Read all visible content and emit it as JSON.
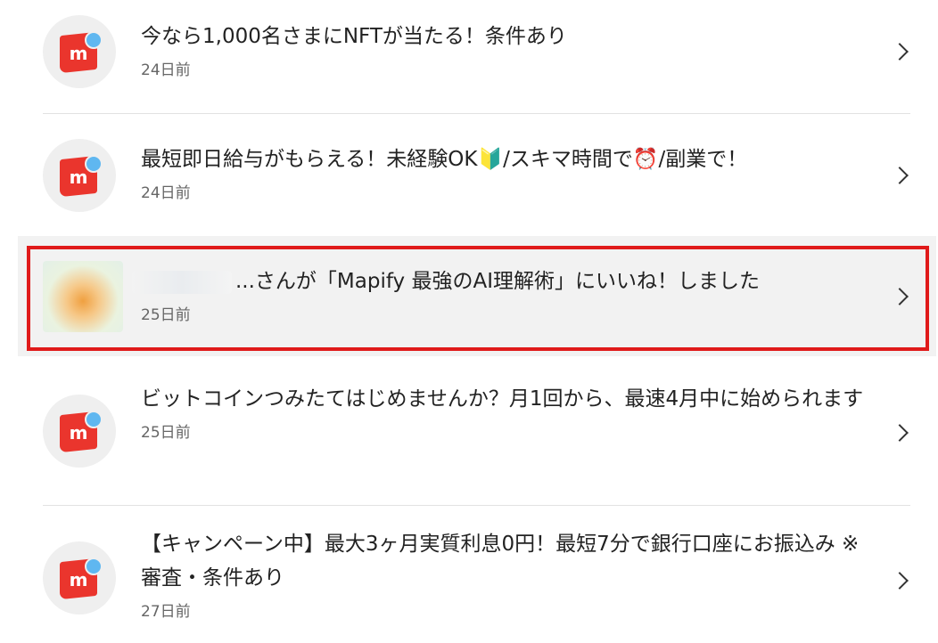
{
  "notifications": [
    {
      "title": "今なら1,000名さまにNFTが当たる！条件あり",
      "time": "24日前",
      "icon": "mercari-logo-icon"
    },
    {
      "title_parts": [
        "最短即日給与がもらえる！未経験OK",
        "🔰",
        "/スキマ時間で",
        "⏰",
        "/副業で！"
      ],
      "time": "24日前",
      "icon": "mercari-logo-icon"
    },
    {
      "title": "...さんが「Mapify 最強のAI理解術」にいいね！しました",
      "time": "25日前",
      "icon": "item-thumbnail",
      "highlighted": true
    },
    {
      "title": "ビットコインつみたてはじめませんか？月1回から、最速4月中に始められます",
      "time": "25日前",
      "icon": "mercari-logo-icon"
    },
    {
      "title": "【キャンペーン中】最大3ヶ月実質利息0円！最短7分で銀行口座にお振込み ※審査・条件あり",
      "time": "27日前",
      "icon": "mercari-logo-icon"
    }
  ],
  "logo_letter": "m",
  "colors": {
    "brand_red": "#ea352d",
    "badge_blue": "#5fb7f0",
    "highlight_border": "#e01a1a"
  }
}
